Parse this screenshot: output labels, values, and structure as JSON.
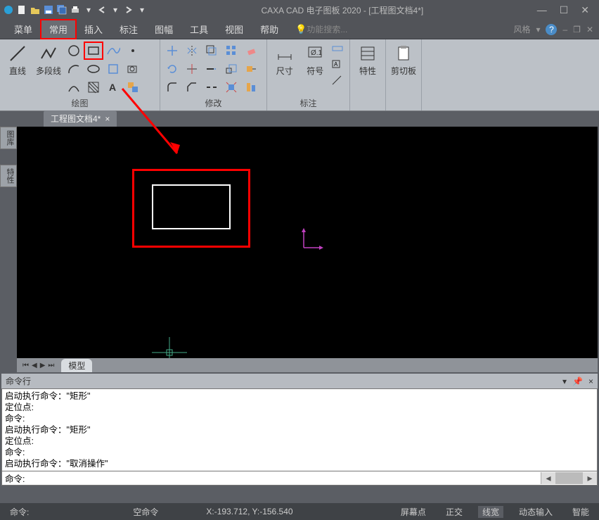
{
  "title": "CAXA CAD 电子图板 2020 - [工程图文档4*]",
  "menu": [
    "菜单",
    "常用",
    "插入",
    "标注",
    "图幅",
    "工具",
    "视图",
    "帮助"
  ],
  "search_placeholder": "功能搜索...",
  "style_label": "风格",
  "ribbon": {
    "draw_label": "绘图",
    "line": "直线",
    "polyline": "多段线",
    "modify_label": "修改",
    "dim_label": "标注",
    "dim_size": "尺寸",
    "dim_symbol": "符号",
    "prop": "特性",
    "clip": "剪切板"
  },
  "doc_tab": "工程图文档4*",
  "side_tabs": [
    "图库",
    "特性"
  ],
  "model_tab": "模型",
  "cmd_title": "命令行",
  "cmd_history": [
    "启动执行命令：\"矩形\"",
    "定位点:",
    "命令:",
    "启动执行命令：\"矩形\"",
    "定位点:",
    "命令:",
    "启动执行命令：\"取消操作\""
  ],
  "cmd_prompt": "命令:",
  "status": {
    "cmd": "命令:",
    "empty": "空命令",
    "coords": "X:-193.712, Y:-156.540",
    "screen": "屏幕点",
    "ortho": "正交",
    "lwt": "线宽",
    "dyn": "动态输入",
    "smart": "智能"
  }
}
